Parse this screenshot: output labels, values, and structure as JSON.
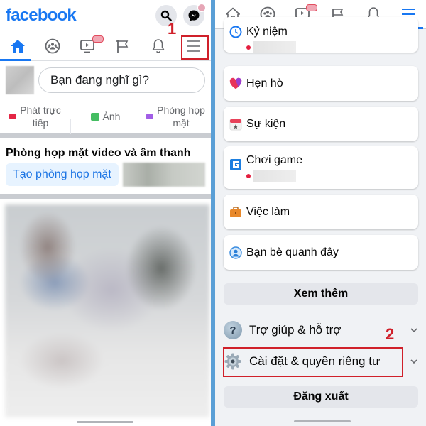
{
  "left": {
    "logo": "facebook",
    "header_icons": [
      "search-icon",
      "messenger-icon"
    ],
    "tabs": [
      {
        "name": "home",
        "icon": "home-icon",
        "active": true
      },
      {
        "name": "groups",
        "icon": "groups-icon",
        "active": false
      },
      {
        "name": "watch",
        "icon": "video-icon",
        "active": false,
        "badge": true
      },
      {
        "name": "pages",
        "icon": "flag-icon",
        "active": false
      },
      {
        "name": "notifications",
        "icon": "bell-icon",
        "active": false
      },
      {
        "name": "menu",
        "icon": "menu-icon",
        "active": false
      }
    ],
    "annotation_1": "1",
    "composer_placeholder": "Bạn đang nghĩ gì?",
    "actions": [
      {
        "label": "Phát trực tiếp",
        "line1": "Phát trực",
        "line2": "tiếp",
        "icon": "live-video-icon",
        "color": "#e42645"
      },
      {
        "label": "Ảnh",
        "line1": "Ảnh",
        "line2": "",
        "icon": "photo-icon",
        "color": "#45bd62"
      },
      {
        "label": "Phòng họp mặt",
        "line1": "Phòng họp",
        "line2": "mặt",
        "icon": "room-icon",
        "color": "#a25ee6"
      }
    ],
    "rooms_title": "Phòng họp mặt video và âm thanh",
    "create_room_label": "Tạo phòng họp mặt"
  },
  "right": {
    "tabs": [
      {
        "name": "home",
        "icon": "home-icon",
        "active": false
      },
      {
        "name": "groups",
        "icon": "groups-icon",
        "active": false
      },
      {
        "name": "watch",
        "icon": "video-icon",
        "active": false,
        "badge": true
      },
      {
        "name": "pages",
        "icon": "flag-icon",
        "active": false
      },
      {
        "name": "notifications",
        "icon": "bell-icon",
        "active": false
      },
      {
        "name": "menu",
        "icon": "menu-icon",
        "active": true
      }
    ],
    "menu_items": [
      {
        "label": "Kỷ niệm",
        "icon": "memories-icon",
        "has_notice": true
      },
      {
        "label": "Hẹn hò",
        "icon": "dating-icon",
        "has_notice": false
      },
      {
        "label": "Sự kiện",
        "icon": "events-icon",
        "has_notice": false
      },
      {
        "label": "Chơi game",
        "icon": "gaming-icon",
        "has_notice": true
      },
      {
        "label": "Việc làm",
        "icon": "jobs-icon",
        "has_notice": false
      },
      {
        "label": "Bạn bè quanh đây",
        "icon": "nearby-friends-icon",
        "has_notice": false
      }
    ],
    "see_more_label": "Xem thêm",
    "help_label": "Trợ giúp & hỗ trợ",
    "settings_label": "Cài đặt & quyền riêng tư",
    "logout_label": "Đăng xuất",
    "annotation_2": "2"
  },
  "colors": {
    "brand": "#1877f2",
    "annotation": "#d0202a",
    "divider": "#5a9fd6"
  }
}
